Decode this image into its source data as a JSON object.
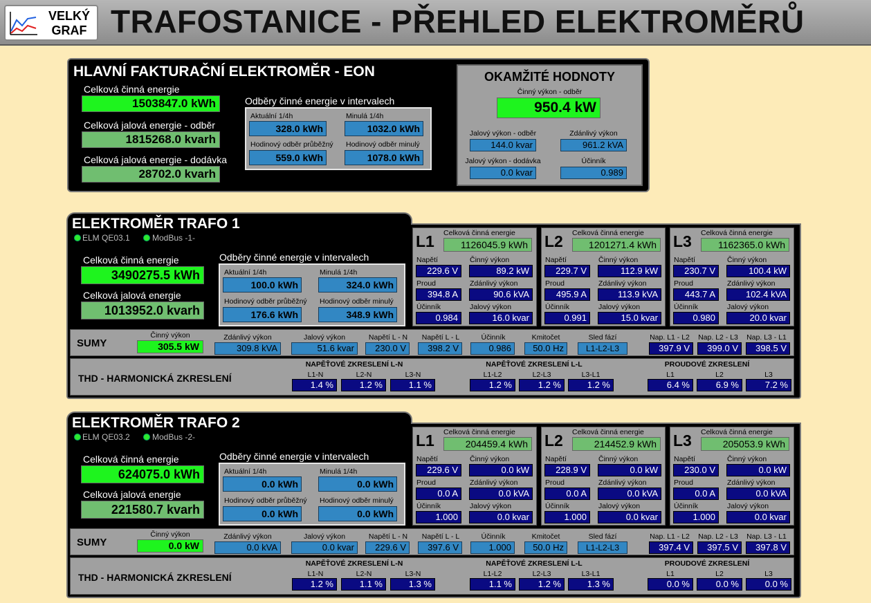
{
  "header": {
    "title": "TRAFOSTANICE - PŘEHLED ELEKTROMĚRŮ",
    "graph_btn_line1": "VELKÝ",
    "graph_btn_line2": "GRAF"
  },
  "main": {
    "title": "HLAVNÍ FAKTURAČNÍ ELEKTROMĚR - EON",
    "e_active_label": "Celková činná energie",
    "e_active": "1503847.0 kWh",
    "e_react_in_label": "Celková jalová energie - odběr",
    "e_react_in": "1815268.0 kvarh",
    "e_react_out_label": "Celková jalová energie - dodávka",
    "e_react_out": "28702.0 kvarh",
    "int_title": "Odběry činné energie v intervalech",
    "int": {
      "akt_label": "Aktuální 1/4h",
      "akt": "328.0 kWh",
      "min_label": "Minulá 1/4h",
      "min": "1032.0 kWh",
      "hod_label": "Hodinový odběr průběžný",
      "hod": "559.0 kWh",
      "hodmin_label": "Hodinový odběr minulý",
      "hodmin": "1078.0 kWh"
    },
    "inst": {
      "title": "OKAMŽITÉ HODNOTY",
      "p_label": "Činný výkon - odběr",
      "p": "950.4 kW",
      "q_in_label": "Jalový výkon - odběr",
      "q_in": "144.0 kvar",
      "s_label": "Zdánlivý výkon",
      "s": "961.2 kVA",
      "q_out_label": "Jalový výkon - dodávka",
      "q_out": "0.0 kvar",
      "pf_label": "Účinník",
      "pf": "0.989"
    }
  },
  "labels": {
    "elm_active": "Celková činná energie",
    "elm_react": "Celková jalová energie",
    "int_title": "Odběry činné energie v intervalech",
    "akt": "Aktuální 1/4h",
    "min": "Minulá 1/4h",
    "hod": "Hodinový odběr průběžný",
    "hodmin": "Hodinový odběr minulý",
    "phase_energy": "Celková činná energie",
    "u": "Napětí",
    "p": "Činný výkon",
    "i": "Proud",
    "s": "Zdánlivý výkon",
    "pf": "Účinník",
    "q": "Jalový výkon",
    "sumy": "SUMY",
    "sum_p": "Činný výkon",
    "sum_s": "Zdánlivý výkon",
    "sum_q": "Jalový výkon",
    "sum_uln": "Napětí L - N",
    "sum_ull": "Napětí L - L",
    "sum_pf": "Účinník",
    "sum_f": "Kmitočet",
    "sum_seq": "Sled fází",
    "sum_u12": "Nap. L1 - L2",
    "sum_u23": "Nap. L2 - L3",
    "sum_u31": "Nap. L3 - L1",
    "thd_title": "THD - HARMONICKÁ ZKRESLENÍ",
    "thd_ln": "NAPĚŤOVÉ ZKRESLENÍ L-N",
    "thd_ll": "NAPĚŤOVÉ ZKRESLENÍ L-L",
    "thd_i": "PROUDOVÉ ZKRESLENÍ",
    "l1n": "L1-N",
    "l2n": "L2-N",
    "l3n": "L3-N",
    "l12": "L1-L2",
    "l23": "L2-L3",
    "l31": "L3-L1",
    "l1": "L1",
    "l2": "L2",
    "l3": "L3"
  },
  "trafo1": {
    "title": "ELEKTROMĚR TRAFO 1",
    "status1": "ELM QE03.1",
    "status2": "ModBus -1-",
    "e_active": "3490275.5 kWh",
    "e_react": "1013952.0 kvarh",
    "int": {
      "akt": "100.0 kWh",
      "min": "324.0 kWh",
      "hod": "176.6 kWh",
      "hodmin": "348.9 kWh"
    },
    "phases": [
      {
        "name": "L1",
        "energy": "1126045.9 kWh",
        "u": "229.6 V",
        "p": "89.2 kW",
        "i": "394.8 A",
        "s": "90.6 kVA",
        "pf": "0.984",
        "q": "16.0 kvar"
      },
      {
        "name": "L2",
        "energy": "1201271.4 kWh",
        "u": "229.7 V",
        "p": "112.9 kW",
        "i": "495.9 A",
        "s": "113.9 kVA",
        "pf": "0.991",
        "q": "15.0 kvar"
      },
      {
        "name": "L3",
        "energy": "1162365.0 kWh",
        "u": "230.7 V",
        "p": "100.4 kW",
        "i": "443.7 A",
        "s": "102.4 kVA",
        "pf": "0.980",
        "q": "20.0 kvar"
      }
    ],
    "sum": {
      "p": "305.5 kW",
      "s": "309.8 kVA",
      "q": "51.6 kvar",
      "uln": "230.0 V",
      "ull": "398.2 V",
      "pf": "0.986",
      "f": "50.0 Hz",
      "seq": "L1-L2-L3",
      "u12": "397.9 V",
      "u23": "399.0 V",
      "u31": "398.5 V"
    },
    "thd": {
      "l1n": "1.4 %",
      "l2n": "1.2 %",
      "l3n": "1.1 %",
      "l12": "1.2 %",
      "l23": "1.2 %",
      "l31": "1.2 %",
      "i1": "6.4 %",
      "i2": "6.9 %",
      "i3": "7.2 %"
    }
  },
  "trafo2": {
    "title": "ELEKTROMĚR TRAFO 2",
    "status1": "ELM QE03.2",
    "status2": "ModBus -2-",
    "e_active": "624075.0 kWh",
    "e_react": "221580.7 kvarh",
    "int": {
      "akt": "0.0 kWh",
      "min": "0.0 kWh",
      "hod": "0.0 kWh",
      "hodmin": "0.0 kWh"
    },
    "phases": [
      {
        "name": "L1",
        "energy": "204459.4 kWh",
        "u": "229.6 V",
        "p": "0.0 kW",
        "i": "0.0 A",
        "s": "0.0 kVA",
        "pf": "1.000",
        "q": "0.0 kvar"
      },
      {
        "name": "L2",
        "energy": "214452.9 kWh",
        "u": "228.9 V",
        "p": "0.0 kW",
        "i": "0.0 A",
        "s": "0.0 kVA",
        "pf": "1.000",
        "q": "0.0 kvar"
      },
      {
        "name": "L3",
        "energy": "205053.9 kWh",
        "u": "230.0 V",
        "p": "0.0 kW",
        "i": "0.0 A",
        "s": "0.0 kVA",
        "pf": "1.000",
        "q": "0.0 kvar"
      }
    ],
    "sum": {
      "p": "0.0 kW",
      "s": "0.0 kVA",
      "q": "0.0 kvar",
      "uln": "229.6 V",
      "ull": "397.6 V",
      "pf": "1.000",
      "f": "50.0 Hz",
      "seq": "L1-L2-L3",
      "u12": "397.4 V",
      "u23": "397.5 V",
      "u31": "397.8 V"
    },
    "thd": {
      "l1n": "1.2 %",
      "l2n": "1.1 %",
      "l3n": "1.3 %",
      "l12": "1.1 %",
      "l23": "1.2 %",
      "l31": "1.3 %",
      "i1": "0.0 %",
      "i2": "0.0 %",
      "i3": "0.0 %"
    }
  }
}
